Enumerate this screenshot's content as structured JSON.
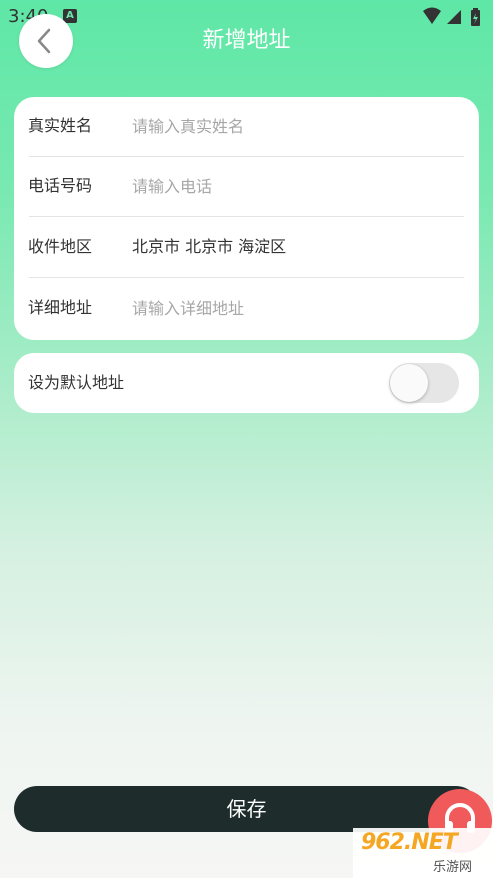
{
  "status_bar": {
    "time": "3:40",
    "app_icon_letter": "A",
    "icons": [
      "wifi-icon",
      "signal-icon",
      "battery-icon"
    ]
  },
  "header": {
    "title": "新增地址",
    "back_icon": "chevron-left-icon"
  },
  "form": {
    "rows": [
      {
        "label": "真实姓名",
        "placeholder": "请输入真实姓名",
        "value": ""
      },
      {
        "label": "电话号码",
        "placeholder": "请输入电话",
        "value": ""
      },
      {
        "label": "收件地区",
        "value": "北京市 北京市 海淀区"
      },
      {
        "label": "详细地址",
        "placeholder": "请输入详细地址",
        "value": ""
      }
    ]
  },
  "default_address": {
    "label": "设为默认地址",
    "enabled": false
  },
  "actions": {
    "save_label": "保存"
  },
  "floating": {
    "support_icon": "headset-icon"
  },
  "watermark": {
    "logo": "962.NET",
    "subtitle": "乐游网"
  },
  "colors": {
    "header_gradient_top": "#5ee7a6",
    "save_button_bg": "#1e2d2c",
    "support_button_bg": "#f05a5a",
    "toggle_off_bg": "#e6e6e6"
  }
}
